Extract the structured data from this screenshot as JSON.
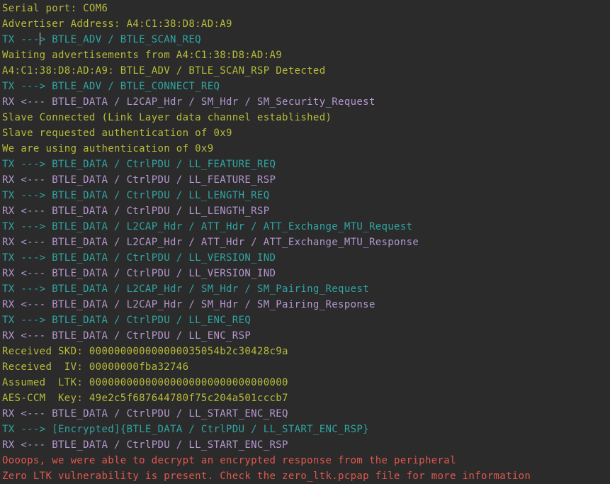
{
  "colors": {
    "background": "#2b2b2b",
    "info": "#b7bc3a",
    "tx": "#2fa5a3",
    "rx": "#b497cf",
    "error": "#e0584d",
    "cursor": "#d8d8d8"
  },
  "lines": [
    {
      "kind": "info",
      "text": "Serial port: COM6"
    },
    {
      "kind": "info",
      "text": "Advertiser Address: A4:C1:38:D8:AD:A9"
    },
    {
      "kind": "tx",
      "text": "TX ---> BTLE_ADV / BTLE_SCAN_REQ"
    },
    {
      "kind": "info",
      "text": "Waiting advertisements from A4:C1:38:D8:AD:A9"
    },
    {
      "kind": "info",
      "text": "A4:C1:38:D8:AD:A9: BTLE_ADV / BTLE_SCAN_RSP Detected"
    },
    {
      "kind": "tx",
      "text": "TX ---> BTLE_ADV / BTLE_CONNECT_REQ"
    },
    {
      "kind": "rx",
      "text": "RX <--- BTLE_DATA / L2CAP_Hdr / SM_Hdr / SM_Security_Request"
    },
    {
      "kind": "info",
      "text": "Slave Connected (Link Layer data channel established)"
    },
    {
      "kind": "info",
      "text": "Slave requested authentication of 0x9"
    },
    {
      "kind": "info",
      "text": "We are using authentication of 0x9"
    },
    {
      "kind": "tx",
      "text": "TX ---> BTLE_DATA / CtrlPDU / LL_FEATURE_REQ"
    },
    {
      "kind": "rx",
      "text": "RX <--- BTLE_DATA / CtrlPDU / LL_FEATURE_RSP"
    },
    {
      "kind": "tx",
      "text": "TX ---> BTLE_DATA / CtrlPDU / LL_LENGTH_REQ"
    },
    {
      "kind": "rx",
      "text": "RX <--- BTLE_DATA / CtrlPDU / LL_LENGTH_RSP"
    },
    {
      "kind": "tx",
      "text": "TX ---> BTLE_DATA / L2CAP_Hdr / ATT_Hdr / ATT_Exchange_MTU_Request"
    },
    {
      "kind": "rx",
      "text": "RX <--- BTLE_DATA / L2CAP_Hdr / ATT_Hdr / ATT_Exchange_MTU_Response"
    },
    {
      "kind": "tx",
      "text": "TX ---> BTLE_DATA / CtrlPDU / LL_VERSION_IND"
    },
    {
      "kind": "rx",
      "text": "RX <--- BTLE_DATA / CtrlPDU / LL_VERSION_IND"
    },
    {
      "kind": "tx",
      "text": "TX ---> BTLE_DATA / L2CAP_Hdr / SM_Hdr / SM_Pairing_Request"
    },
    {
      "kind": "rx",
      "text": "RX <--- BTLE_DATA / L2CAP_Hdr / SM_Hdr / SM_Pairing_Response"
    },
    {
      "kind": "tx",
      "text": "TX ---> BTLE_DATA / CtrlPDU / LL_ENC_REQ"
    },
    {
      "kind": "rx",
      "text": "RX <--- BTLE_DATA / CtrlPDU / LL_ENC_RSP"
    },
    {
      "kind": "info",
      "text": "Received SKD: 000000000000000035054b2c30428c9a"
    },
    {
      "kind": "info",
      "text": "Received  IV: 00000000fba32746"
    },
    {
      "kind": "info",
      "text": "Assumed  LTK: 00000000000000000000000000000000"
    },
    {
      "kind": "info",
      "text": "AES-CCM  Key: 49e2c5f687644780f75c204a501cccb7"
    },
    {
      "kind": "rx",
      "text": "RX <--- BTLE_DATA / CtrlPDU / LL_START_ENC_REQ"
    },
    {
      "kind": "tx",
      "text": "TX ---> [Encrypted]{BTLE_DATA / CtrlPDU / LL_START_ENC_RSP}"
    },
    {
      "kind": "rx",
      "text": "RX <--- BTLE_DATA / CtrlPDU / LL_START_ENC_RSP"
    },
    {
      "kind": "error",
      "text": "Oooops, we were able to decrypt an encrypted response from the peripheral"
    },
    {
      "kind": "error",
      "text": "Zero LTK vulnerability is present. Check the zero_ltk.pcpap file for more information"
    }
  ]
}
